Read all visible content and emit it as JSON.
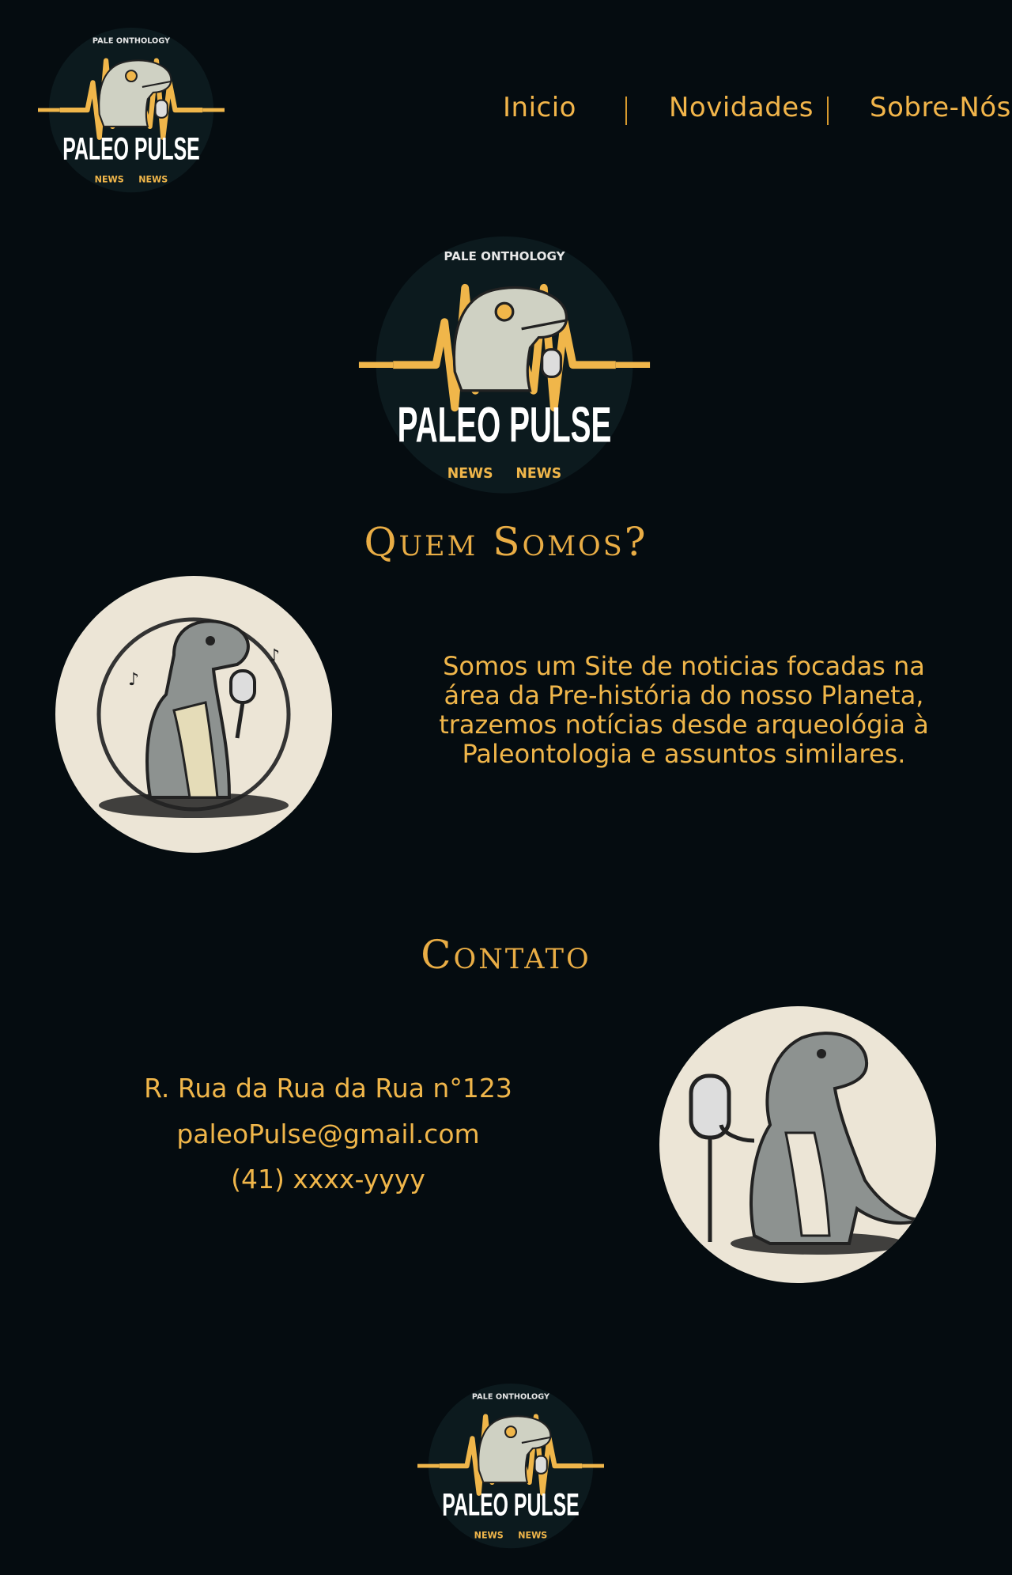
{
  "header": {
    "logo": {
      "ring_text": "PALE ONTHOLOGY",
      "title": "PALEO PULSE",
      "tag_left": "NEWS",
      "tag_right": "NEWS"
    },
    "nav": [
      {
        "label": "Inicio"
      },
      {
        "label": "Novidades"
      },
      {
        "label": "Sobre-Nós"
      }
    ]
  },
  "hero_logo": {
    "ring_text": "PALE ONTHOLOGY",
    "title": "PALEO PULSE",
    "tag_left": "NEWS",
    "tag_right": "NEWS"
  },
  "about": {
    "heading": "Quem Somos?",
    "text": "Somos um Site de noticias focadas na área da Pre-história do nosso Planeta, trazemos notícias desde arqueológia à Paleontologia e assuntos similares."
  },
  "contact": {
    "heading": "Contato",
    "address": "R. Rua da Rua da Rua n°123",
    "email": "paleoPulse@gmail.com",
    "phone": "(41) xxxx-yyyy"
  },
  "footer": {
    "logo": {
      "ring_text": "PALE ONTHOLOGY",
      "title": "PALEO PULSE",
      "tag_left": "NEWS",
      "tag_right": "NEWS"
    }
  },
  "colors": {
    "background": "#050c10",
    "accent": "#f0b64a",
    "logo_badge": "#0c1a1e",
    "circle_bg": "#ece5d6",
    "dino": "#8d9290"
  },
  "icons": [
    "paleo-pulse-logo",
    "singing-dino-illustration",
    "trex-microphone-illustration"
  ]
}
